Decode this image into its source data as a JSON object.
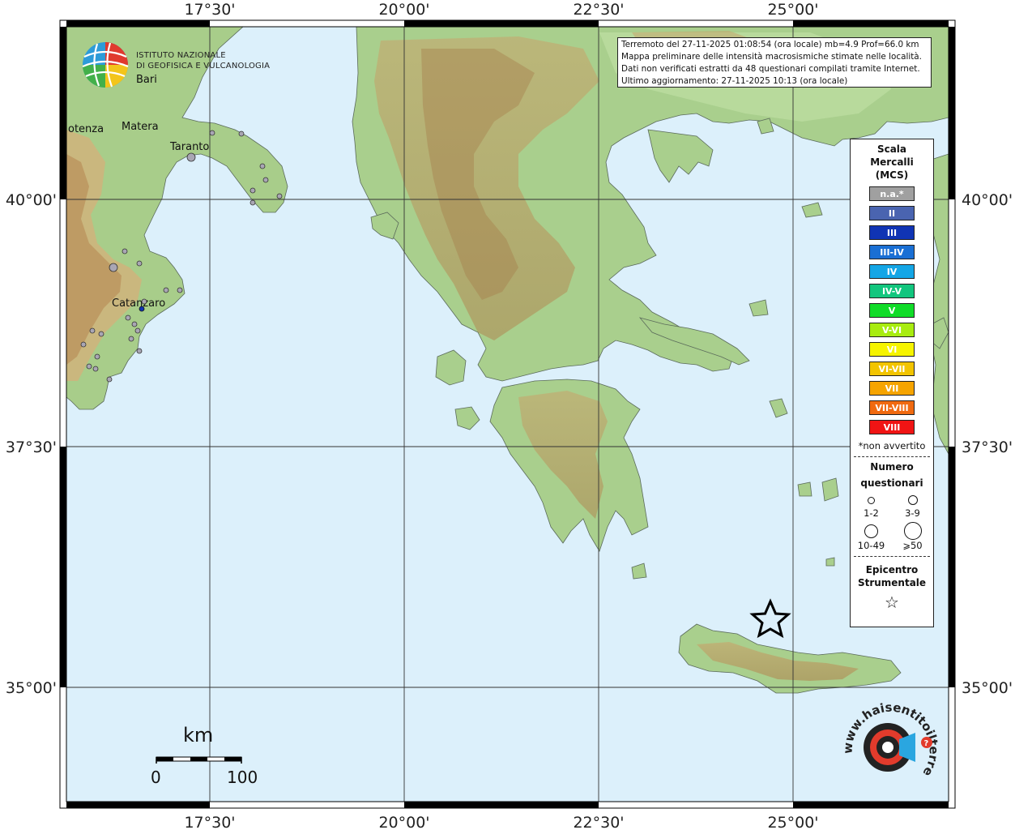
{
  "map": {
    "top_ticks": [
      "17°30'",
      "20°00'",
      "22°30'",
      "25°00'"
    ],
    "bottom_ticks": [
      "17°30'",
      "20°00'",
      "22°30'",
      "25°00'"
    ],
    "left_ticks": [
      "40°00'",
      "37°30'",
      "35°00'"
    ],
    "right_ticks": [
      "40°00'",
      "37°30'",
      "35°00'"
    ],
    "cities": [
      "Bari",
      "otenza",
      "Matera",
      "Taranto",
      "Catanzaro"
    ],
    "sea_color": "#dceefb"
  },
  "info_box": {
    "line1": "Terremoto del 27-11-2025 01:08:54 (ora locale) mb=4.9 Prof=66.0 km",
    "line2": "Mappa preliminare delle intensità macrosismiche stimate nelle località.",
    "line3": "Dati non verificati estratti da 48 questionari compilati tramite Internet.",
    "line4": "Ultimo aggiornamento: 27-11-2025 10:13 (ora locale)"
  },
  "logo": {
    "line1": "ISTITUTO NAZIONALE",
    "line2": "DI GEOFISICA E VULCANOLOGIA"
  },
  "legend": {
    "title1": "Scala",
    "title2": "Mercalli",
    "title3": "(MCS)",
    "items": [
      {
        "label": "n.a.*",
        "color": "#a0a0a0"
      },
      {
        "label": "II",
        "color": "#4a64b0"
      },
      {
        "label": "III",
        "color": "#1034b4"
      },
      {
        "label": "III-IV",
        "color": "#1a6fd4"
      },
      {
        "label": "IV",
        "color": "#14a6e6"
      },
      {
        "label": "IV-V",
        "color": "#12c67e"
      },
      {
        "label": "V",
        "color": "#10dc28"
      },
      {
        "label": "V-VI",
        "color": "#a8ec10"
      },
      {
        "label": "VI",
        "color": "#f6f400"
      },
      {
        "label": "VI-VII",
        "color": "#f2c400"
      },
      {
        "label": "VII",
        "color": "#f6a400"
      },
      {
        "label": "VII-VIII",
        "color": "#f06a10"
      },
      {
        "label": "VIII",
        "color": "#f01414"
      }
    ],
    "note": "*non avvertito",
    "q_title1": "Numero",
    "q_title2": "questionari",
    "q_labels": [
      "1-2",
      "3-9",
      "10-49",
      "⩾50"
    ],
    "epi1": "Epicentro",
    "epi2": "Strumentale",
    "epi_symbol": "☆"
  },
  "scale": {
    "unit": "km",
    "min": "0",
    "max": "100"
  },
  "hst": {
    "text": "www.haisentitoilterremoto.it"
  }
}
